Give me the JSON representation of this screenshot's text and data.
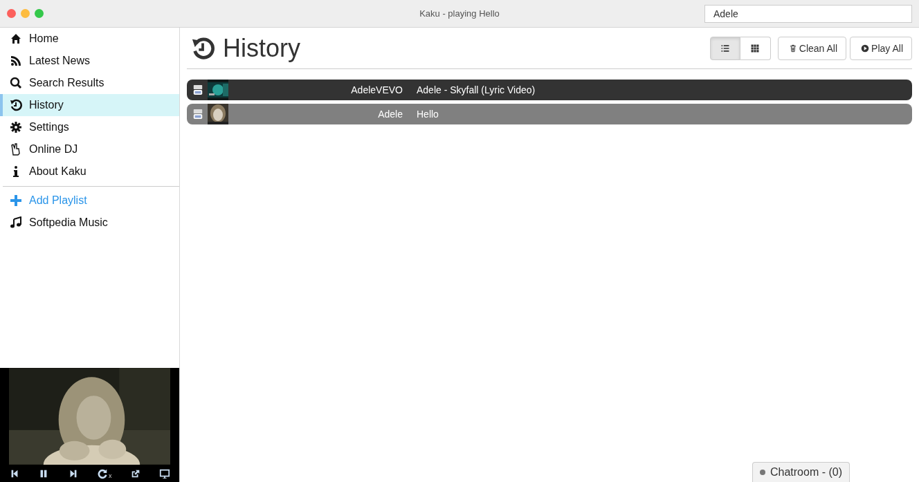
{
  "window": {
    "title": "Kaku - playing Hello"
  },
  "search": {
    "value": "Adele"
  },
  "sidebar": {
    "items": [
      {
        "label": "Home",
        "selected": false
      },
      {
        "label": "Latest News",
        "selected": false
      },
      {
        "label": "Search Results",
        "selected": false
      },
      {
        "label": "History",
        "selected": true
      },
      {
        "label": "Settings",
        "selected": false
      },
      {
        "label": "Online DJ",
        "selected": false
      },
      {
        "label": "About Kaku",
        "selected": false
      }
    ],
    "playlists": [
      {
        "label": "Add Playlist",
        "kind": "action"
      },
      {
        "label": "Softpedia Music",
        "kind": "playlist"
      }
    ]
  },
  "player": {
    "repeat_badge": "x"
  },
  "main": {
    "title": "History",
    "views": [
      {
        "selected": true
      },
      {
        "selected": false
      }
    ],
    "buttons": [
      {
        "label": "Clean All"
      },
      {
        "label": "Play All"
      }
    ],
    "tracks": [
      {
        "channel": "AdeleVEVO",
        "title": "Adele - Skyfall (Lyric Video)",
        "playing": false
      },
      {
        "channel": "Adele",
        "title": "Hello",
        "playing": true
      }
    ]
  },
  "chatroom": {
    "label": "Chatroom - (0)"
  }
}
